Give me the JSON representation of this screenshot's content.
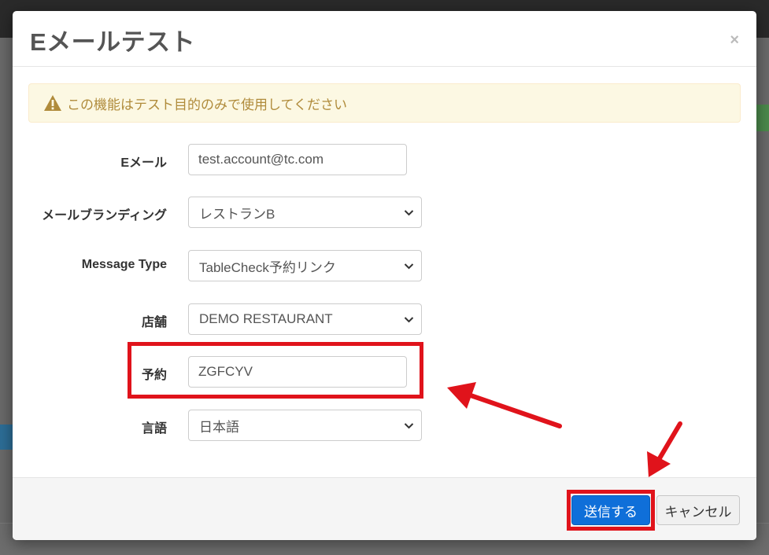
{
  "modal": {
    "title": "Eメールテスト",
    "close_symbol": "×"
  },
  "alert": {
    "icon": "warning-icon",
    "text": "この機能はテスト目的のみで使用してください",
    "color": "#b08b3b"
  },
  "form": {
    "email": {
      "label": "Eメール",
      "value": "test.account@tc.com"
    },
    "branding": {
      "label": "メールブランディング",
      "selected": "レストランB"
    },
    "message_type": {
      "label": "Message Type",
      "selected": "TableCheck予約リンク"
    },
    "store": {
      "label": "店舗",
      "selected": "DEMO RESTAURANT"
    },
    "reservation": {
      "label": "予約",
      "value": "ZGFCYV"
    },
    "language": {
      "label": "言語",
      "selected": "日本語"
    }
  },
  "footer": {
    "send_label": "送信する",
    "cancel_label": "キャンセル"
  },
  "colors": {
    "primary": "#0f6fd9",
    "highlight": "#e0131b"
  }
}
